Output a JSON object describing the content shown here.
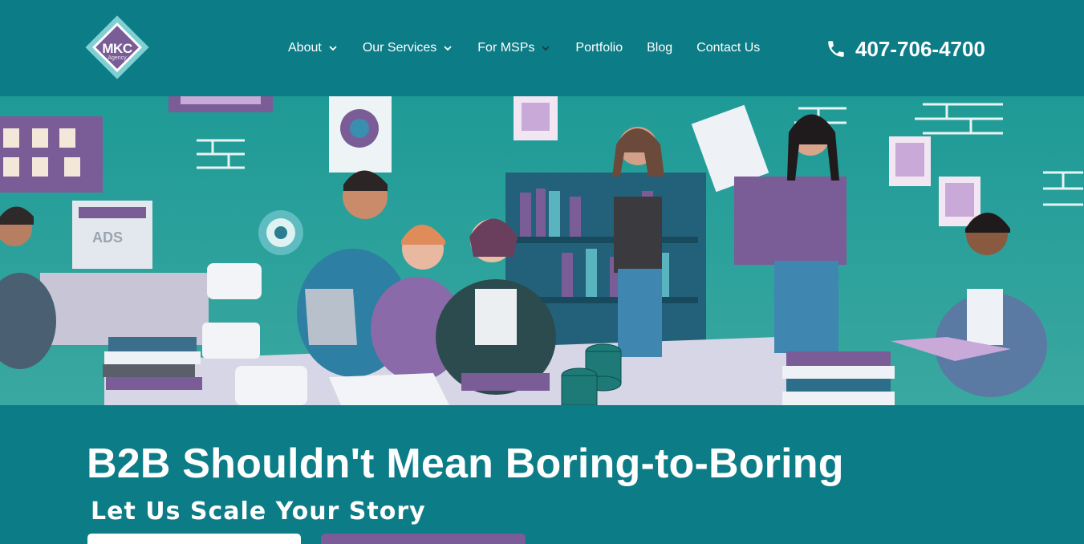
{
  "brand": {
    "logo_text": "MKC",
    "logo_sub": "Agency"
  },
  "nav": {
    "items": [
      {
        "label": "About",
        "has_dropdown": true
      },
      {
        "label": "Our Services",
        "has_dropdown": true
      },
      {
        "label": "For MSPs",
        "has_dropdown": true
      },
      {
        "label": "Portfolio",
        "has_dropdown": false
      },
      {
        "label": "Blog",
        "has_dropdown": false
      },
      {
        "label": "Contact Us",
        "has_dropdown": false
      }
    ]
  },
  "header": {
    "phone": "407-706-4700",
    "phone_icon": "phone-icon"
  },
  "hero": {
    "illustration_text": "ADS"
  },
  "main": {
    "headline": "B2B Shouldn't Mean Boring-to-Boring",
    "subheadline": "Let Us Scale Your Story",
    "primary_button_label": "",
    "secondary_button_label": ""
  },
  "colors": {
    "background": "#0c7c86",
    "accent_purple": "#7b5b98",
    "white": "#ffffff"
  }
}
